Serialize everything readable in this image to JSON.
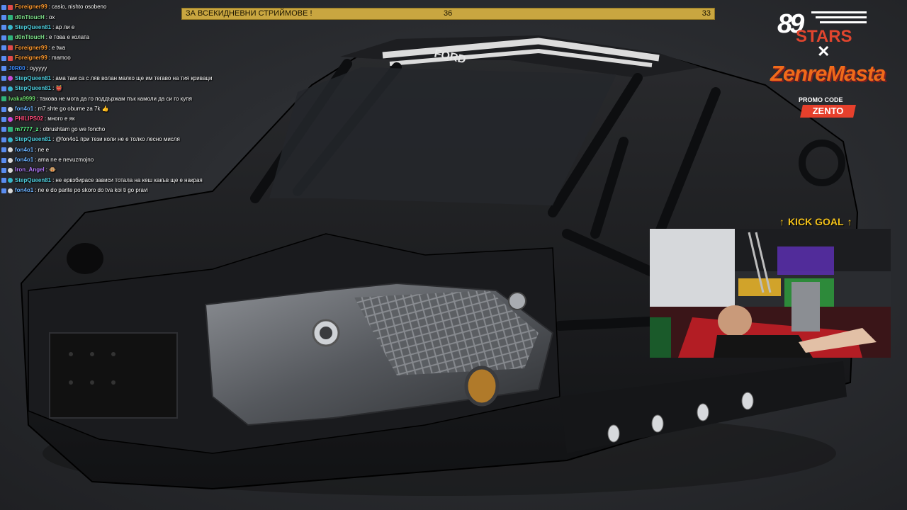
{
  "chat": {
    "messages": [
      {
        "user": "Foreigner99",
        "user_color": "#ff9a2f",
        "text": "casio, nishto osobeno",
        "badges": [
          "blue",
          "red"
        ]
      },
      {
        "user": "d0nTtoucH",
        "user_color": "#7ee08a",
        "text": "ох",
        "badges": [
          "blue",
          "grn"
        ]
      },
      {
        "user": "StepQueen81",
        "user_color": "#4fd0e0",
        "text": "ар ли е",
        "badges": [
          "blue",
          "cyan"
        ]
      },
      {
        "user": "d0nTtoucH",
        "user_color": "#7ee08a",
        "text": "е това е колата",
        "badges": [
          "blue",
          "grn"
        ]
      },
      {
        "user": "Foreigner99",
        "user_color": "#ff9a2f",
        "text": "е twa",
        "badges": [
          "blue",
          "red"
        ]
      },
      {
        "user": "Foreigner99",
        "user_color": "#ff9a2f",
        "text": "mamoo",
        "badges": [
          "blue",
          "red"
        ]
      },
      {
        "user": "J0R00",
        "user_color": "#3a8bff",
        "text": "oyyyyy",
        "badges": [
          "blue"
        ]
      },
      {
        "user": "StepQueen81",
        "user_color": "#4fd0e0",
        "text": "ама там са с ляв волан малко ще им тегаво на тия криваци",
        "badges": [
          "blue",
          "pink"
        ]
      },
      {
        "user": "StepQueen81",
        "user_color": "#4fd0e0",
        "text": "👹",
        "badges": [
          "blue",
          "cyan"
        ]
      },
      {
        "user": "Ivaka9999",
        "user_color": "#6fdc6f",
        "text": "такова не мога да го поддържам пък камоли да си го купя",
        "badges": [
          "grn"
        ]
      },
      {
        "user": "fon4o1",
        "user_color": "#6bb2ff",
        "text": "m7 shte go oburne za 7k 👍",
        "badges": [
          "blue",
          "wht"
        ]
      },
      {
        "user": "PHILIPS02",
        "user_color": "#ff4a7a",
        "text": "много е як",
        "badges": [
          "blue",
          "pink"
        ]
      },
      {
        "user": "m7777_z",
        "user_color": "#5cff8a",
        "text": "obrushtam go we foncho",
        "badges": [
          "blue",
          "grn"
        ]
      },
      {
        "user": "StepQueen81",
        "user_color": "#4fd0e0",
        "text": "@fon4o1 при тези коли не е толко лесно мисля",
        "badges": [
          "blue",
          "cyan"
        ]
      },
      {
        "user": "fon4o1",
        "user_color": "#6bb2ff",
        "text": "ne e",
        "badges": [
          "blue",
          "wht"
        ]
      },
      {
        "user": "fon4o1",
        "user_color": "#6bb2ff",
        "text": "ama ne e nevuzmojno",
        "badges": [
          "blue",
          "wht"
        ]
      },
      {
        "user": "Iron_Angel",
        "user_color": "#b57bff",
        "text": "🐵",
        "badges": [
          "blue",
          "wht"
        ]
      },
      {
        "user": "StepQueen81",
        "user_color": "#4fd0e0",
        "text": "не ервзбирасе зависи тотала на кеш какъв ще е накрая",
        "badges": [
          "blue",
          "cyan"
        ]
      },
      {
        "user": "fon4o1",
        "user_color": "#6bb2ff",
        "text": "ne e do parite po skoro do tva koi ti go pravi",
        "badges": [
          "blue",
          "wht"
        ]
      }
    ]
  },
  "goal_bar": {
    "label": "ЗА ВСЕКИДНЕВНИ СТРИЙМОВЕ !",
    "current": "36",
    "target": "33"
  },
  "sponsor": {
    "number": "89",
    "stars": "STARS",
    "times": "✕",
    "brand": "ZenreMasta",
    "promo_label": "PROMO CODE",
    "promo_code": "ZENTO"
  },
  "kick_goal": {
    "label": "KICK GOAL",
    "arrow": "↑"
  },
  "car_badge": "FORD",
  "icons": {
    "arrow": "arrow-up-icon",
    "webcam": "webcam-feed"
  },
  "colors": {
    "goal_bar": "#c9a640",
    "kick_goal": "#f4c21a",
    "stars": "#e0452e",
    "zenremasta": "#f06a1a",
    "zento_bg": "#e6402c"
  }
}
